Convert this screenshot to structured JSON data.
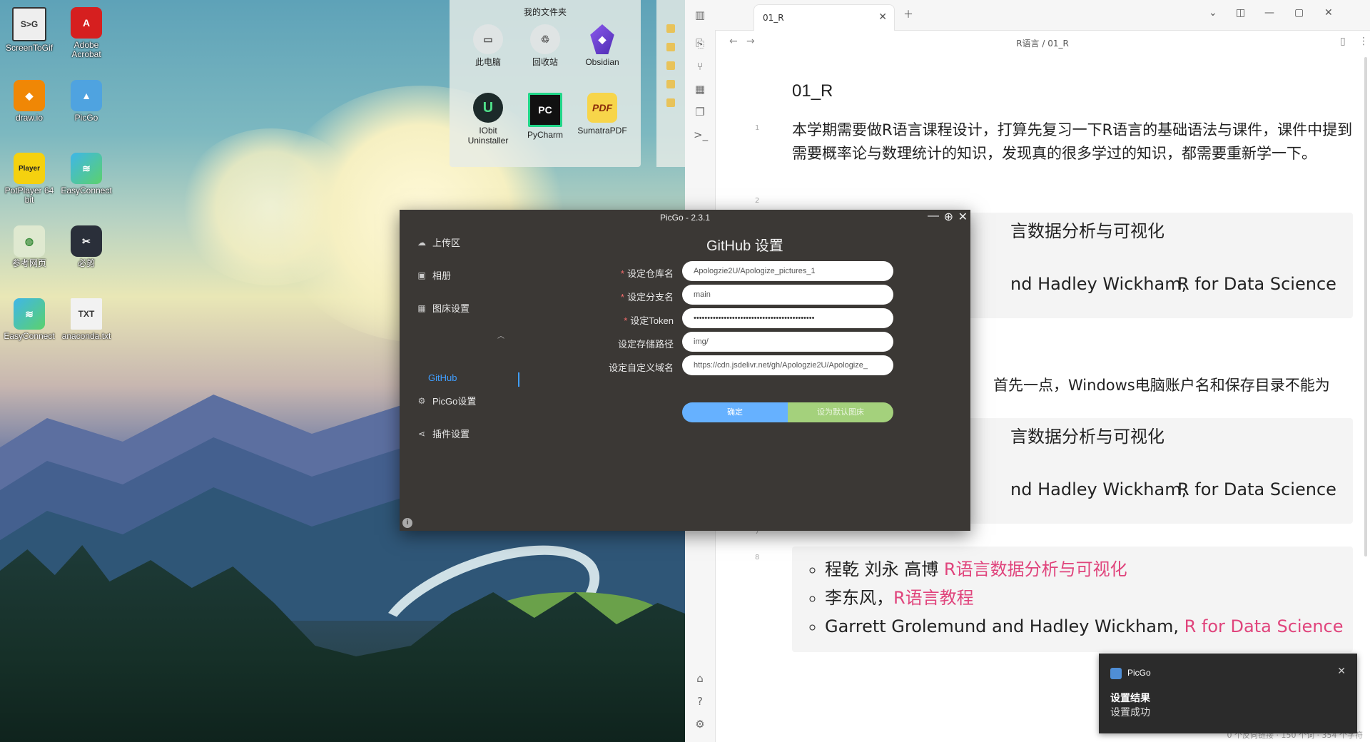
{
  "desktop": {
    "icons": [
      {
        "label": "ScreenToGif",
        "icon": "screentogif-icon"
      },
      {
        "label": "Adobe Acrobat",
        "icon": "acrobat-icon"
      },
      {
        "label": "draw.io",
        "icon": "drawio-icon"
      },
      {
        "label": "PicGo",
        "icon": "picgo-icon"
      },
      {
        "label": "PotPlayer 64 bit",
        "icon": "potplayer-icon",
        "glyph": "Player"
      },
      {
        "label": "EasyConnect",
        "icon": "easyconnect-icon"
      },
      {
        "label": "参考网页",
        "icon": "web-shortcut-icon"
      },
      {
        "label": "必剪",
        "icon": "bijian-icon"
      },
      {
        "label": "EasyConnect",
        "icon": "easyconnect-icon"
      },
      {
        "label": "anaconda.txt",
        "icon": "txt-file-icon",
        "glyph": "TXT"
      }
    ],
    "folder_popup": {
      "title": "我的文件夹",
      "items": [
        {
          "label": "此电脑",
          "icon": "this-pc-icon"
        },
        {
          "label": "回收站",
          "icon": "recycle-bin-icon"
        },
        {
          "label": "Obsidian",
          "icon": "obsidian-icon"
        },
        {
          "label": "IObit Uninstaller",
          "icon": "iobit-icon",
          "glyph": "U"
        },
        {
          "label": "PyCharm",
          "icon": "pycharm-icon",
          "glyph": "PC"
        },
        {
          "label": "SumatraPDF",
          "icon": "sumatrapdf-icon",
          "glyph": "PDF"
        }
      ]
    }
  },
  "obsidian": {
    "tab_title": "01_R",
    "breadcrumb": "R语言 / 01_R",
    "note_title": "01_R",
    "line_numbers": [
      "1",
      "2",
      "7",
      "8"
    ],
    "paragraph": "本学期需要做R语言课程设计，打算先复习一下R语言的基础语法与课件，课件中提到需要概率论与数理统计的知识，发现真的很多学过的知识，都需要重新学一下。",
    "callout1_line1": "言数据分析与可视化",
    "callout1_line2_plain": "nd Hadley Wickham,",
    "callout1_line2_link": "R for Data Science",
    "mid_text": "首先一点，Windows电脑账户名和保存目录不能为",
    "callout2_line1": "言数据分析与可视化",
    "callout2_line2_plain": "nd Hadley Wickham,",
    "callout2_line2_link": "R for Data Science",
    "list": [
      {
        "plain": "程乾 刘永 高博",
        "link": "R语言数据分析与可视化"
      },
      {
        "plain": "李东风，",
        "link": "R语言教程"
      },
      {
        "plain": "Garrett Grolemund and Hadley Wickham,",
        "link": "R for Data Science"
      }
    ],
    "status_text": "0 个反向链接  ·  150 个词  ·  354 个字符"
  },
  "picgo": {
    "window_title": "PicGo - 2.3.1",
    "sidebar": {
      "upload": "上传区",
      "gallery": "相册",
      "bed_settings": "图床设置",
      "github": "GitHub",
      "picgo_settings": "PicGo设置",
      "plugin_settings": "插件设置"
    },
    "heading": "GitHub 设置",
    "fields": {
      "repo": {
        "label": "设定仓库名",
        "required": true,
        "value": "Apologzie2U/Apologize_pictures_1"
      },
      "branch": {
        "label": "设定分支名",
        "required": true,
        "value": "main"
      },
      "token": {
        "label": "设定Token",
        "required": true,
        "value": "••••••••••••••••••••••••••••••••••••••••••••"
      },
      "path": {
        "label": "设定存储路径",
        "required": false,
        "value": "img/"
      },
      "domain": {
        "label": "设定自定义域名",
        "required": false,
        "value": "https://cdn.jsdelivr.net/gh/Apologzie2U/Apologize_"
      }
    },
    "confirm_button": "确定",
    "default_button": "设为默认图床",
    "required_mark": "*"
  },
  "toast": {
    "app": "PicGo",
    "title": "设置结果",
    "body": "设置成功"
  },
  "colors": {
    "picgo_bg": "#3b3835",
    "picgo_accent": "#409eff",
    "confirm": "#66b1ff",
    "default": "#a4d17c",
    "link_pink": "#e0447c",
    "toast_bg": "#2b2b2b"
  }
}
